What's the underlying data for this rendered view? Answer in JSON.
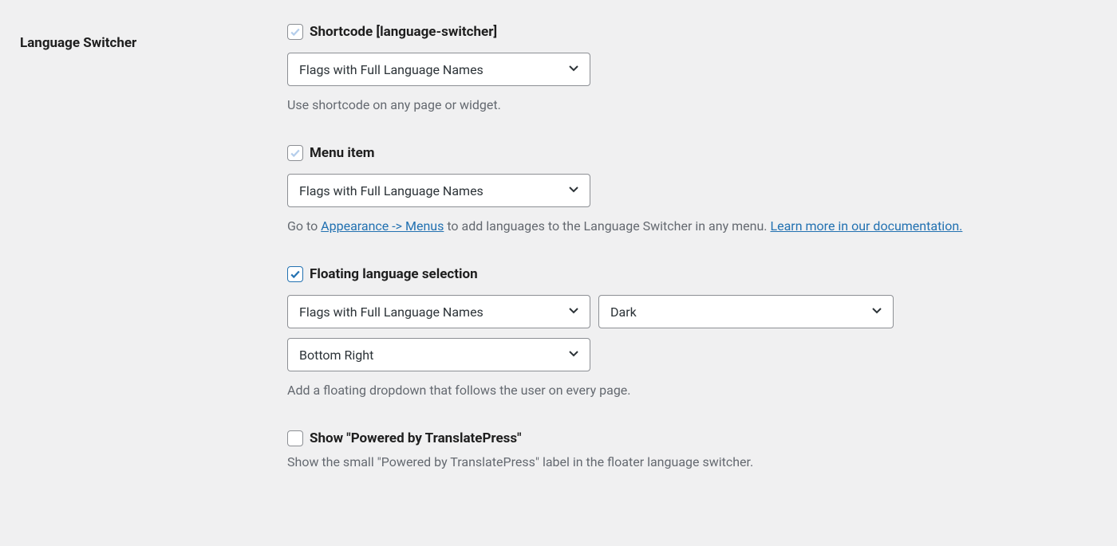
{
  "heading": "Language Switcher",
  "shortcode": {
    "checked": true,
    "label": "Shortcode [language-switcher]",
    "select_value": "Flags with Full Language Names",
    "help": "Use shortcode on any page or widget."
  },
  "menu_item": {
    "checked": true,
    "label": "Menu item",
    "select_value": "Flags with Full Language Names",
    "help_prefix": "Go to ",
    "help_link1": "Appearance -> Menus",
    "help_middle": " to add languages to the Language Switcher in any menu. ",
    "help_link2": "Learn more in our documentation."
  },
  "floating": {
    "checked": true,
    "label": "Floating language selection",
    "select_style": "Flags with Full Language Names",
    "select_theme": "Dark",
    "select_position": "Bottom Right",
    "help": "Add a floating dropdown that follows the user on every page."
  },
  "powered_by": {
    "checked": false,
    "label": "Show \"Powered by TranslatePress\"",
    "help": "Show the small \"Powered by TranslatePress\" label in the floater language switcher."
  }
}
